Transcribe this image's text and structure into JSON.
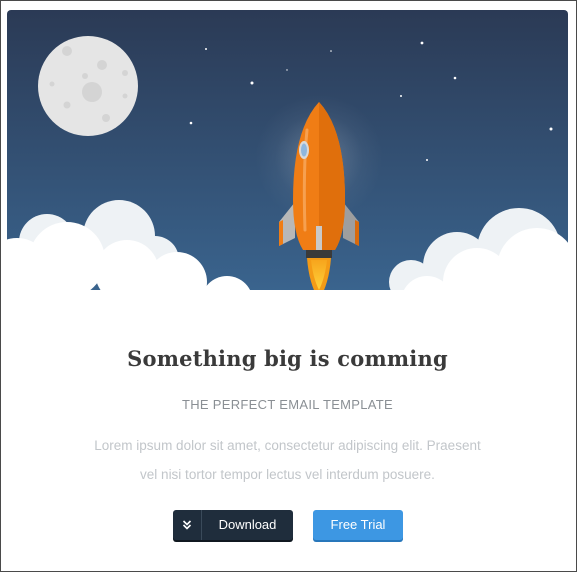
{
  "hero": {
    "scene": "rocket-launch",
    "sky_colors": [
      "#2b3a55",
      "#3b6792"
    ],
    "rocket_color": "#f07d15",
    "moon_color": "#e5e5e5",
    "cloud_color": "#ffffff"
  },
  "content": {
    "headline": "Something big is comming",
    "subheadline": "THE PERFECT EMAIL TEMPLATE",
    "body_line1": "Lorem ipsum dolor sit amet, consectetur adipiscing elit. Praesent",
    "body_line2": "vel nisi tortor tempor lectus vel interdum posuere."
  },
  "buttons": {
    "download_label": "Download",
    "download_icon": "double-chevron-down-icon",
    "trial_label": "Free Trial",
    "download_color": "#1f2d3c",
    "trial_color": "#3d97e3"
  }
}
